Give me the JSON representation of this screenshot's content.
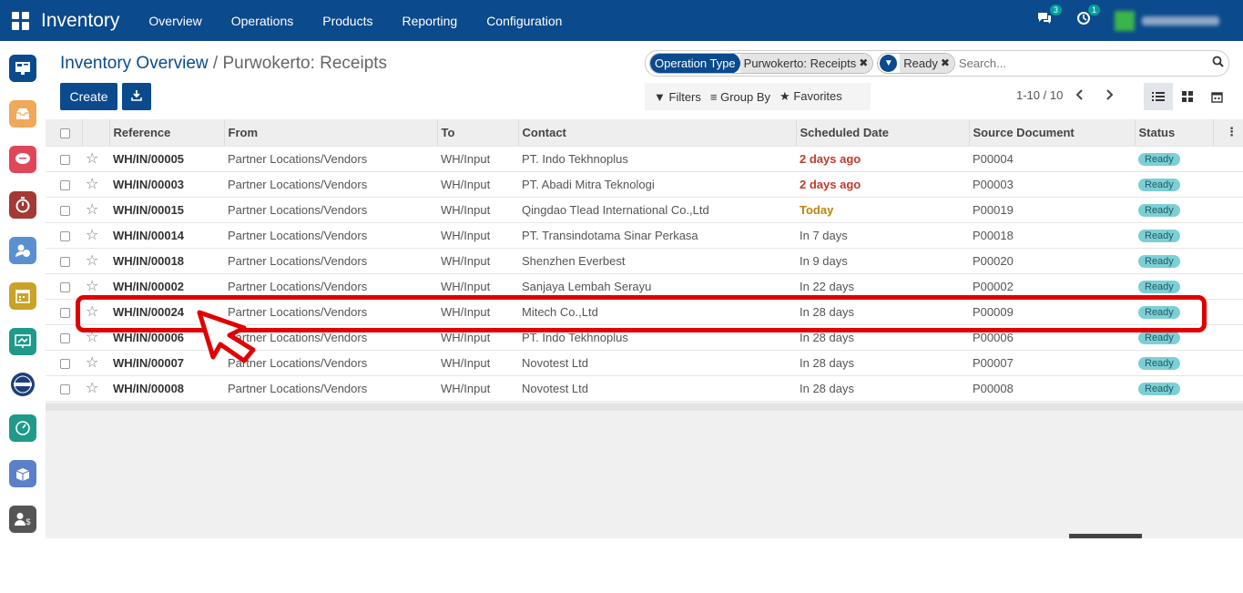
{
  "topbar": {
    "brand": "Inventory",
    "menu": [
      "Overview",
      "Operations",
      "Products",
      "Reporting",
      "Configuration"
    ],
    "messages_count": "3",
    "activities_count": "1"
  },
  "breadcrumb": {
    "parent": "Inventory Overview",
    "separator": "/",
    "current": "Purwokerto: Receipts"
  },
  "toolbar": {
    "create_label": "Create"
  },
  "search": {
    "facet_label": "Operation Type",
    "facet_value": "Purwokerto: Receipts",
    "filter_value": "Ready",
    "placeholder": "Search..."
  },
  "filters": {
    "filters_label": "Filters",
    "groupby_label": "Group By",
    "favorites_label": "Favorites"
  },
  "pager": {
    "range": "1-10 / 10"
  },
  "table": {
    "headers": [
      "Reference",
      "From",
      "To",
      "Contact",
      "Scheduled Date",
      "Source Document",
      "Status"
    ],
    "rows": [
      {
        "reference": "WH/IN/00005",
        "from": "Partner Locations/Vendors",
        "to": "WH/Input",
        "contact": "PT. Indo Tekhnoplus",
        "scheduled": "2 days ago",
        "source": "P00004",
        "status": "Ready"
      },
      {
        "reference": "WH/IN/00003",
        "from": "Partner Locations/Vendors",
        "to": "WH/Input",
        "contact": "PT. Abadi Mitra Teknologi",
        "scheduled": "2 days ago",
        "source": "P00003",
        "status": "Ready"
      },
      {
        "reference": "WH/IN/00015",
        "from": "Partner Locations/Vendors",
        "to": "WH/Input",
        "contact": "Qingdao Tlead International Co.,Ltd",
        "scheduled": "Today",
        "source": "P00019",
        "status": "Ready"
      },
      {
        "reference": "WH/IN/00014",
        "from": "Partner Locations/Vendors",
        "to": "WH/Input",
        "contact": "PT. Transindotama Sinar Perkasa",
        "scheduled": "In 7 days",
        "source": "P00018",
        "status": "Ready"
      },
      {
        "reference": "WH/IN/00018",
        "from": "Partner Locations/Vendors",
        "to": "WH/Input",
        "contact": "Shenzhen Everbest",
        "scheduled": "In 9 days",
        "source": "P00020",
        "status": "Ready"
      },
      {
        "reference": "WH/IN/00002",
        "from": "Partner Locations/Vendors",
        "to": "WH/Input",
        "contact": "Sanjaya Lembah Serayu",
        "scheduled": "In 22 days",
        "source": "P00002",
        "status": "Ready"
      },
      {
        "reference": "WH/IN/00024",
        "from": "Partner Locations/Vendors",
        "to": "WH/Input",
        "contact": "Mitech Co.,Ltd",
        "scheduled": "In 28 days",
        "source": "P00009",
        "status": "Ready"
      },
      {
        "reference": "WH/IN/00006",
        "from": "Partner Locations/Vendors",
        "to": "WH/Input",
        "contact": "PT. Indo Tekhnoplus",
        "scheduled": "In 28 days",
        "source": "P00006",
        "status": "Ready"
      },
      {
        "reference": "WH/IN/00007",
        "from": "Partner Locations/Vendors",
        "to": "WH/Input",
        "contact": "Novotest Ltd",
        "scheduled": "In 28 days",
        "source": "P00007",
        "status": "Ready"
      },
      {
        "reference": "WH/IN/00008",
        "from": "Partner Locations/Vendors",
        "to": "WH/Input",
        "contact": "Novotest Ltd",
        "scheduled": "In 28 days",
        "source": "P00008",
        "status": "Ready"
      }
    ]
  },
  "colors": {
    "primary": "#0b4a8c",
    "late": "#c0392b",
    "today": "#b8860b",
    "status_badge": "#7ccfd5",
    "highlight": "#e00000"
  },
  "sidebar_icons": [
    "dashboard-icon",
    "inbox-icon",
    "discuss-icon",
    "timer-icon",
    "attendance-icon",
    "calendar-icon",
    "presentation-icon",
    "company-logo-icon",
    "dashboard-gauge-icon",
    "inventory-box-icon",
    "payroll-icon"
  ]
}
